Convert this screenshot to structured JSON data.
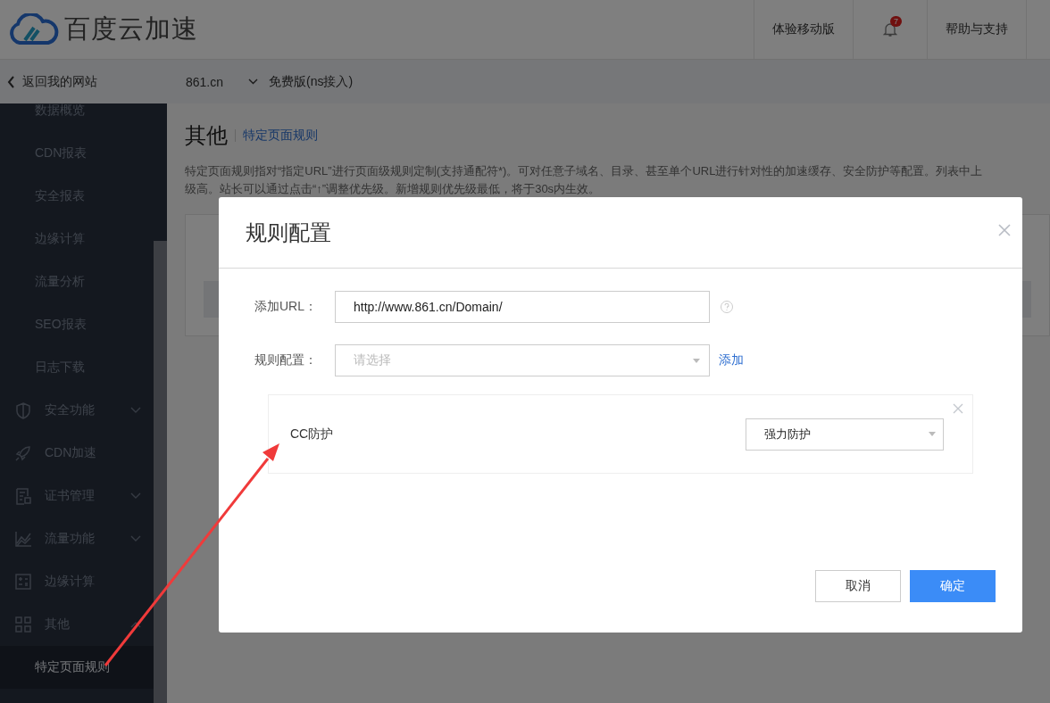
{
  "header": {
    "logo_text": "百度云加速",
    "nav": [
      {
        "kind": "text",
        "label": "体验移动版"
      },
      {
        "kind": "bell",
        "badge": "7"
      },
      {
        "kind": "text",
        "label": "帮助与支持"
      }
    ]
  },
  "subbar": {
    "back": "返回我的网站",
    "domain": "861.cn",
    "plan": "免费版(ns接入)"
  },
  "sidebar": {
    "scrolled_children": [
      {
        "label": "数据概览",
        "selected": false
      },
      {
        "label": "CDN报表",
        "selected": false
      },
      {
        "label": "安全报表",
        "selected": false
      },
      {
        "label": "边缘计算",
        "selected": false
      },
      {
        "label": "流量分析",
        "selected": false
      },
      {
        "label": "SEO报表",
        "selected": false
      },
      {
        "label": "日志下载",
        "selected": false
      }
    ],
    "groups": [
      {
        "kind": "shield",
        "label": "安全功能",
        "expanded": false
      },
      {
        "kind": "rocket",
        "label": "CDN加速"
      },
      {
        "kind": "certificate",
        "label": "证书管理",
        "expanded": false
      },
      {
        "kind": "chart",
        "label": "流量功能",
        "expanded": false
      },
      {
        "kind": "calculator",
        "label": "边缘计算"
      },
      {
        "kind": "grid",
        "label": "其他",
        "expanded": true,
        "children": [
          {
            "label": "特定页面规则",
            "selected": true
          }
        ]
      }
    ]
  },
  "main": {
    "title": "其他",
    "breadcrumb": "特定页面规则",
    "description": [
      "特定页面规则指对“指定URL”进行页面级规则定制(支持通配符*)。可对任意子域名、目录、甚至单个URL进行针对性的加速缓存、安全防护等配置。列表中上",
      "级高。站长可以通过点击“↑”调整优先级。新增规则优先级最低，将于30s内生效。"
    ]
  },
  "modal": {
    "title": "规则配置",
    "fields": [
      {
        "kind": "input",
        "label": "添加URL：",
        "value": "http://www.861.cn/Domain/"
      },
      {
        "kind": "select",
        "label": "规则配置：",
        "placeholder": "请选择",
        "action": "添加"
      }
    ],
    "rules": [
      {
        "name": "CC防护",
        "value": "强力防护"
      }
    ],
    "buttons": [
      {
        "label": "取消",
        "primary": false
      },
      {
        "label": "确定",
        "primary": true
      }
    ]
  }
}
